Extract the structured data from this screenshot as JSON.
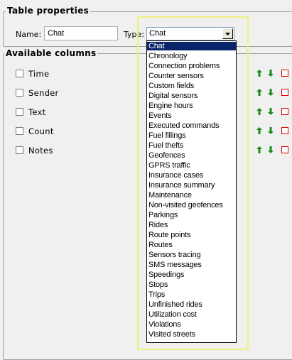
{
  "table_properties": {
    "legend": "Table properties",
    "name_label": "Name:",
    "name_value": "Chat",
    "type_label": "Type:",
    "type_value": "Chat"
  },
  "available_columns": {
    "legend": "Available columns",
    "columns": [
      {
        "label": "Time",
        "checked": false
      },
      {
        "label": "Sender",
        "checked": false
      },
      {
        "label": "Text",
        "checked": false
      },
      {
        "label": "Count",
        "checked": false
      },
      {
        "label": "Notes",
        "checked": false
      }
    ]
  },
  "type_dropdown": {
    "selected": "Chat",
    "options": [
      "Chat",
      "Chronology",
      "Connection problems",
      "Counter sensors",
      "Custom fields",
      "Digital sensors",
      "Engine hours",
      "Events",
      "Executed commands",
      "Fuel fillings",
      "Fuel thefts",
      "Geofences",
      "GPRS traffic",
      "Insurance cases",
      "Insurance summary",
      "Maintenance",
      "Non-visited geofences",
      "Parkings",
      "Rides",
      "Route points",
      "Routes",
      "Sensors tracing",
      "SMS messages",
      "Speedings",
      "Stops",
      "Trips",
      "Unfinished rides",
      "Utilization cost",
      "Violations",
      "Visited streets"
    ]
  },
  "colors": {
    "arrow_green": "#1a8a1a",
    "selection_bg": "#0a246a",
    "highlight_border": "#eef07a",
    "remove_red": "#e00000"
  }
}
